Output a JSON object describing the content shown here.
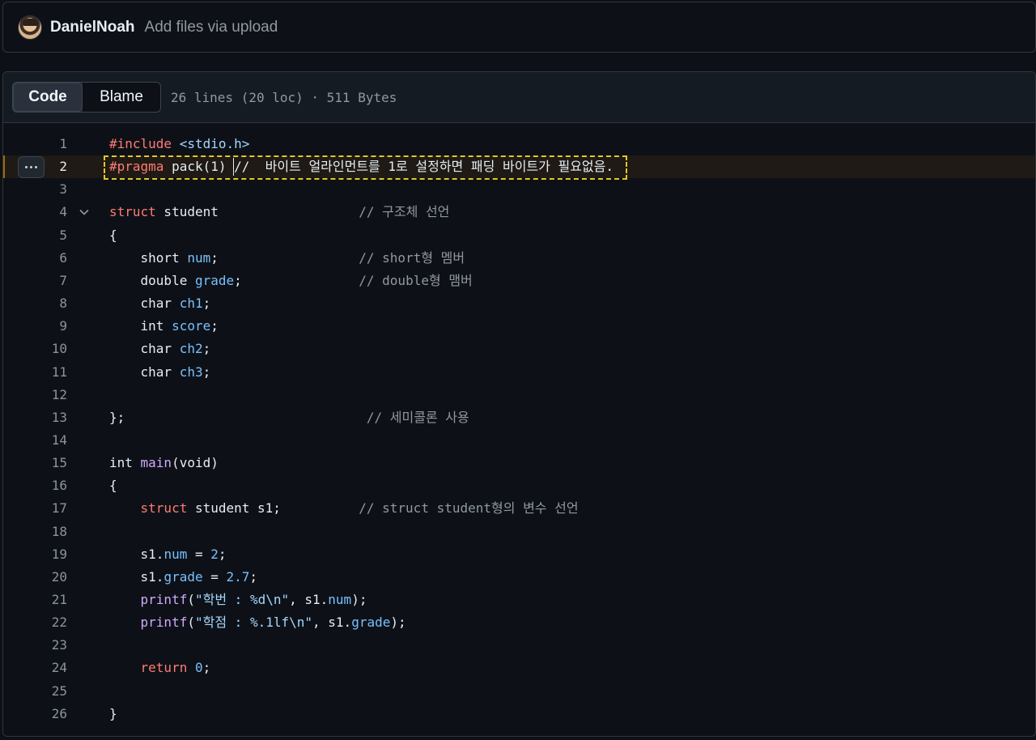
{
  "commit": {
    "author": "DanielNoah",
    "message": "Add files via upload"
  },
  "file_header": {
    "tabs": [
      "Code",
      "Blame"
    ],
    "active_tab": "Code",
    "meta": "26 lines (20 loc) · 511 Bytes"
  },
  "code": {
    "active_line": 2,
    "foldable_line": 4,
    "line_numbers": [
      "1",
      "2",
      "3",
      "4",
      "5",
      "6",
      "7",
      "8",
      "9",
      "10",
      "11",
      "12",
      "13",
      "14",
      "15",
      "16",
      "17",
      "18",
      "19",
      "20",
      "21",
      "22",
      "23",
      "24",
      "25",
      "26"
    ],
    "lines": [
      [
        [
          "k",
          "#include"
        ],
        [
          "t",
          " "
        ],
        [
          "s",
          "<stdio.h>"
        ]
      ],
      [
        [
          "k",
          "#pragma"
        ],
        [
          "t",
          " pack(1) //  바이트 얼라인먼트를 1로 설정하면 패딩 바이트가 필요없음."
        ]
      ],
      [],
      [
        [
          "k",
          "struct"
        ],
        [
          "t",
          " student                  "
        ],
        [
          "c",
          "// 구조체 선언"
        ]
      ],
      [
        [
          "t",
          "{"
        ]
      ],
      [
        [
          "t",
          "    short "
        ],
        [
          "p",
          "num"
        ],
        [
          "t",
          ";                  "
        ],
        [
          "c",
          "// short형 멤버"
        ]
      ],
      [
        [
          "t",
          "    double "
        ],
        [
          "p",
          "grade"
        ],
        [
          "t",
          ";               "
        ],
        [
          "c",
          "// double형 맴버"
        ]
      ],
      [
        [
          "t",
          "    char "
        ],
        [
          "p",
          "ch1"
        ],
        [
          "t",
          ";"
        ]
      ],
      [
        [
          "t",
          "    int "
        ],
        [
          "p",
          "score"
        ],
        [
          "t",
          ";"
        ]
      ],
      [
        [
          "t",
          "    char "
        ],
        [
          "p",
          "ch2"
        ],
        [
          "t",
          ";"
        ]
      ],
      [
        [
          "t",
          "    char "
        ],
        [
          "p",
          "ch3"
        ],
        [
          "t",
          ";"
        ]
      ],
      [],
      [
        [
          "t",
          "};                               "
        ],
        [
          "c",
          "// 세미콜론 사용"
        ]
      ],
      [],
      [
        [
          "t",
          "int "
        ],
        [
          "f",
          "main"
        ],
        [
          "t",
          "(void)"
        ]
      ],
      [
        [
          "t",
          "{"
        ]
      ],
      [
        [
          "t",
          "    "
        ],
        [
          "k",
          "struct"
        ],
        [
          "t",
          " student s1;          "
        ],
        [
          "c",
          "// struct student형의 변수 선언"
        ]
      ],
      [],
      [
        [
          "t",
          "    s1."
        ],
        [
          "p",
          "num"
        ],
        [
          "t",
          " = "
        ],
        [
          "p",
          "2"
        ],
        [
          "t",
          ";"
        ]
      ],
      [
        [
          "t",
          "    s1."
        ],
        [
          "p",
          "grade"
        ],
        [
          "t",
          " = "
        ],
        [
          "p",
          "2.7"
        ],
        [
          "t",
          ";"
        ]
      ],
      [
        [
          "t",
          "    "
        ],
        [
          "f",
          "printf"
        ],
        [
          "t",
          "("
        ],
        [
          "s",
          "\"학번 : %d\\n\""
        ],
        [
          "t",
          ", s1."
        ],
        [
          "p",
          "num"
        ],
        [
          "t",
          ");"
        ]
      ],
      [
        [
          "t",
          "    "
        ],
        [
          "f",
          "printf"
        ],
        [
          "t",
          "("
        ],
        [
          "s",
          "\"학점 : %.1lf\\n\""
        ],
        [
          "t",
          ", s1."
        ],
        [
          "p",
          "grade"
        ],
        [
          "t",
          ");"
        ]
      ],
      [],
      [
        [
          "t",
          "    "
        ],
        [
          "k",
          "return"
        ],
        [
          "t",
          " "
        ],
        [
          "p",
          "0"
        ],
        [
          "t",
          ";"
        ]
      ],
      [],
      [
        [
          "t",
          "}"
        ]
      ]
    ]
  }
}
